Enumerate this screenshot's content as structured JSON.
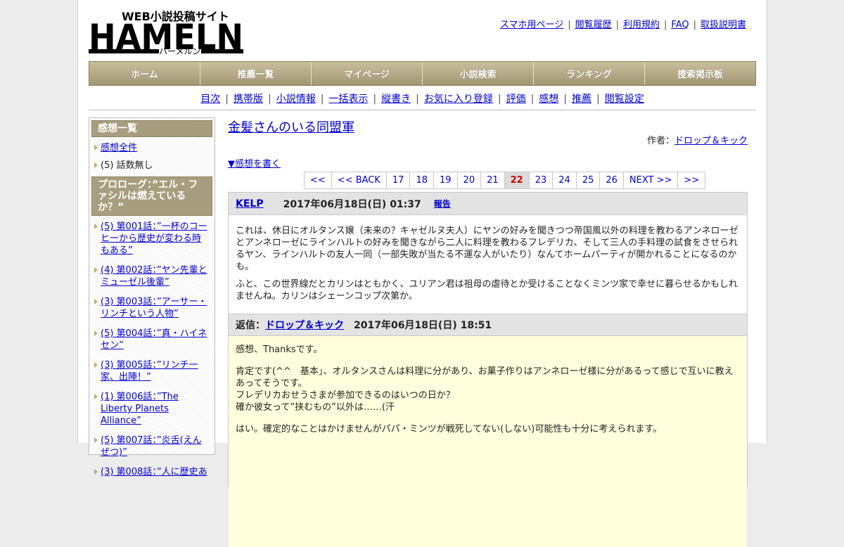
{
  "header": {
    "logo": {
      "top": "WEB小説投稿サイト",
      "main": "HAMELN",
      "sub": "ハーメルン"
    },
    "links": [
      "スマホ用ページ",
      "閲覧履歴",
      "利用規約",
      "FAQ",
      "取扱説明書"
    ]
  },
  "mainnav": [
    "ホーム",
    "推薦一覧",
    "マイページ",
    "小説検索",
    "ランキング",
    "捜索掲示板"
  ],
  "subnav": [
    "目次",
    "携帯版",
    "小説情報",
    "一括表示",
    "縦書き",
    "お気に入り登録",
    "評価",
    "感想",
    "推薦",
    "閲覧設定"
  ],
  "sidebar": {
    "heading": "感想一覧",
    "links": [
      "感想全件"
    ],
    "static": "(5) 話数無し",
    "chapter_heading": "プロローグ：”エル・ファシルは燃えているか？”",
    "chapters": [
      "(5) 第001話：”一杯のコーヒーから歴史が変わる時もある”",
      "(4) 第002話：”ヤン先輩とミューゼル後輩”",
      "(3) 第003話：”アーサー・リンチという人物”",
      "(5) 第004話：”真・ハイネセン”",
      "(3) 第005話：”リンチ一家、出陣！”",
      "(1) 第006話：”The Liberty Planets Alliance”",
      "(5) 第007話：”炎舌(えんぜつ)”",
      "(3) 第008話：”人に歴史あ"
    ]
  },
  "content": {
    "title": "金髪さんのいる同盟軍",
    "author_label": "作者：",
    "author": "ドロップ＆キック",
    "write_link": "▼感想を書く",
    "pager": [
      "<<",
      "<< BACK",
      "17",
      "18",
      "19",
      "20",
      "21",
      "22",
      "23",
      "24",
      "25",
      "26",
      "NEXT >>",
      ">>"
    ],
    "pager_current": "22",
    "review": {
      "user": "KELP",
      "date": "2017年06月18日(日) 01:37",
      "report": "報告",
      "paragraphs": [
        "これは、休日にオルタンス嬢（未来の？キャゼルヌ夫人）にヤンの好みを聞きつつ帝国風以外の料理を教わるアンネローゼとアンネローゼにラインハルトの好みを聞きながら二人に料理を教わるフレデリカ、そして三人の手料理の試食をさせられるヤン、ラインハルトの友人一同（一部失敗が当たる不運な人がいたり）なんてホームパーティが開かれることになるのかも。",
        "ふと、この世界線だとカリンはともかく、ユリアン君は祖母の虐待とか受けることなくミンツ家で幸せに暮らせるかもしれませんね。カリンはシェーンコップ次第か。"
      ]
    },
    "reply": {
      "label": "返信：",
      "author": "ドロップ＆キック",
      "date": "2017年06月18日(日) 18:51",
      "p1": "感想、Thanksです。",
      "p2_lines": [
        "肯定です(^^　基本」、オルタンスさんは料理に分があり、お菓子作りはアンネローゼ様に分があるって感じで互いに教えあってそうです。",
        "フレデリカおせうさまが参加できるのはいつの日か？",
        "確か彼女って”挟むもの”以外は……(汗"
      ],
      "p3": "はい。確定的なことはかけませんがパパ・ミンツが戦死してない(しない)可能性も十分に考えられます。"
    }
  }
}
